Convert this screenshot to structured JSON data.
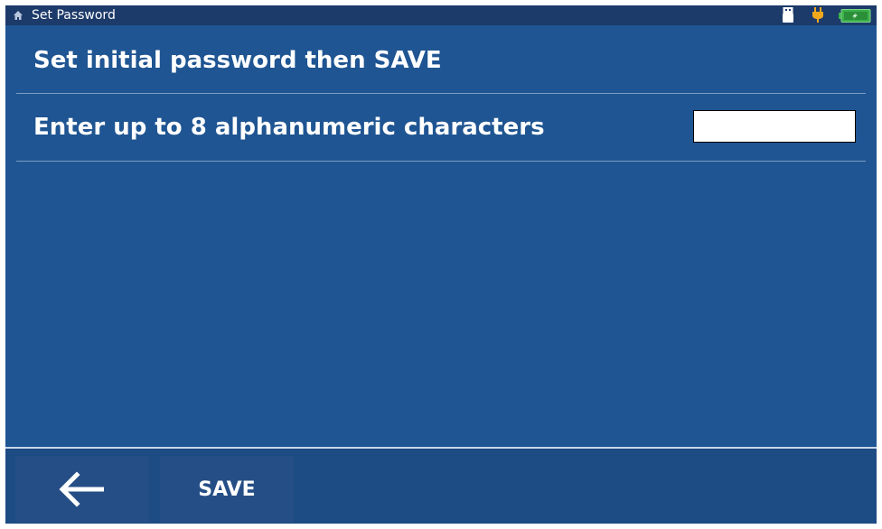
{
  "status_bar": {
    "title": "Set Password",
    "icons": [
      "home-icon",
      "usb-icon",
      "plug-icon",
      "battery-icon"
    ],
    "colors": {
      "plug": "#f2a81d",
      "battery": "#3cb04a"
    }
  },
  "main": {
    "heading": "Set initial password then SAVE",
    "prompt": "Enter up to 8 alphanumeric characters",
    "password_field": {
      "value": "",
      "placeholder": ""
    }
  },
  "bottom_bar": {
    "back_icon": "arrow-left-icon",
    "save_label": "SAVE"
  }
}
